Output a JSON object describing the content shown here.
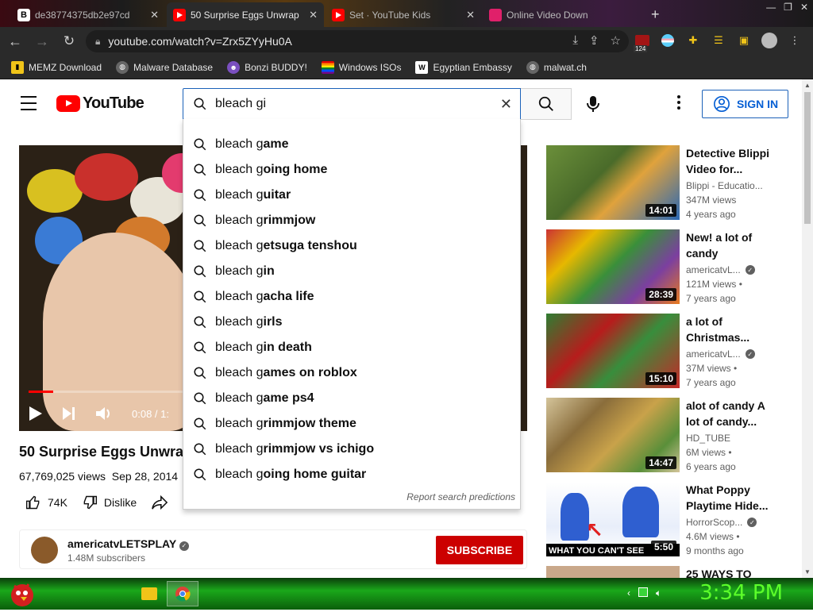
{
  "tabs": [
    {
      "label": "de38774375db2e97cd",
      "favicon": "B",
      "active": false
    },
    {
      "label": "50 Surprise Eggs Unwrap",
      "favicon": "youtube",
      "active": true
    },
    {
      "label": "Set · YouTube Kids",
      "favicon": "youtube",
      "active": false
    },
    {
      "label": "Online Video Down",
      "favicon": "video",
      "active": false
    }
  ],
  "omnibox": {
    "url": "youtube.com/watch?v=Zrx5ZYyHu0A"
  },
  "extensions": {
    "badge": "124"
  },
  "bookmarks": [
    "MEMZ Download",
    "Malware Database",
    "Bonzi BUDDY!",
    "Windows ISOs",
    "Egyptian Embassy",
    "malwat.ch"
  ],
  "masthead": {
    "logo_text": "YouTube",
    "search_value": "bleach gi",
    "signin_label": "SIGN IN"
  },
  "suggestions": [
    {
      "prefix": "bleach g",
      "rest": "ame"
    },
    {
      "prefix": "bleach g",
      "rest": "oing home"
    },
    {
      "prefix": "bleach g",
      "rest": "uitar"
    },
    {
      "prefix": "bleach g",
      "rest": "rimmjow"
    },
    {
      "prefix": "bleach g",
      "rest": "etsuga tenshou"
    },
    {
      "prefix": "bleach g",
      "rest": "in"
    },
    {
      "prefix": "bleach g",
      "rest": "acha life"
    },
    {
      "prefix": "bleach g",
      "rest": "irls"
    },
    {
      "prefix": "bleach g",
      "rest": "in death"
    },
    {
      "prefix": "bleach g",
      "rest": "ames on roblox"
    },
    {
      "prefix": "bleach g",
      "rest": "ame ps4"
    },
    {
      "prefix": "bleach g",
      "rest": "rimmjow theme"
    },
    {
      "prefix": "bleach g",
      "rest": "rimmjow vs ichigo"
    },
    {
      "prefix": "bleach g",
      "rest": "oing home guitar"
    }
  ],
  "suggest_footer": "Report search predictions",
  "player": {
    "time": "0:08 / 1:",
    "progress": 0.05
  },
  "video": {
    "title": "50 Surprise Eggs Unwrap",
    "views": "67,769,025 views",
    "date": "Sep 28, 2014",
    "likes": "74K",
    "dislike": "Dislike"
  },
  "owner": {
    "name": "americatvLETSPLAY",
    "subs": "1.48M subscribers",
    "subscribe_label": "SUBSCRIBE"
  },
  "related": [
    {
      "title": "Detective Blippi Video for...",
      "channel": "Blippi - Educatio...",
      "verified": false,
      "views": "347M views",
      "age": "4 years ago",
      "duration": "14:01"
    },
    {
      "title": "New! a lot of candy",
      "channel": "americatvL...",
      "verified": true,
      "views": "121M views •",
      "age": "7 years ago",
      "duration": "28:39"
    },
    {
      "title": "a lot of Christmas...",
      "channel": "americatvL...",
      "verified": true,
      "views": "37M views •",
      "age": "7 years ago",
      "duration": "15:10"
    },
    {
      "title": "alot of candy A lot of candy...",
      "channel": "HD_TUBE",
      "verified": false,
      "views": "6M views •",
      "age": "6 years ago",
      "duration": "14:47"
    },
    {
      "title": "What Poppy Playtime Hide...",
      "channel": "HorrorScop...",
      "verified": true,
      "views": "4.6M views •",
      "age": "9 months ago",
      "duration": "5:50",
      "overlay": "WHAT YOU CAN'T SEE"
    },
    {
      "title": "25 WAYS TO",
      "channel": "",
      "verified": false,
      "views": "",
      "age": "",
      "duration": ""
    }
  ],
  "taskbar": {
    "clock": "3:34 PM"
  }
}
